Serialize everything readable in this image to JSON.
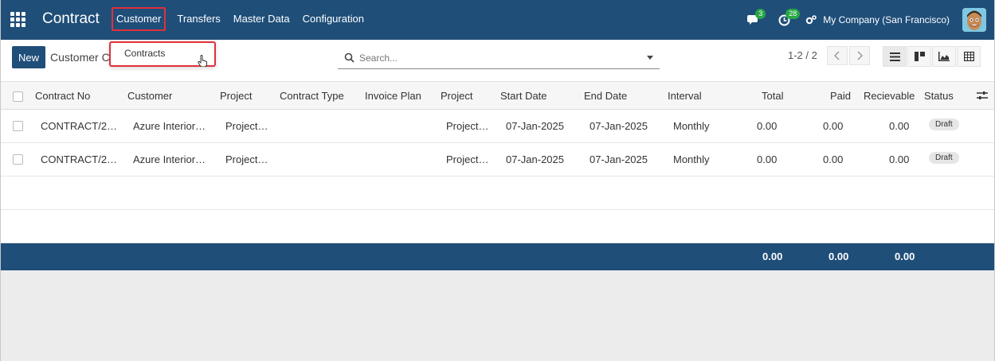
{
  "navbar": {
    "brand": "Contract",
    "menu": [
      "Customer",
      "Transfers",
      "Master Data",
      "Configuration"
    ],
    "messages_count": "3",
    "activities_count": "28",
    "company": "My Company (San Francisco)"
  },
  "dropdown": {
    "item": "Contracts"
  },
  "control": {
    "new_label": "New",
    "breadcrumb": "Customer Contracts",
    "search_placeholder": "Search...",
    "pager": "1-2 / 2"
  },
  "table": {
    "headers": [
      "Contract No",
      "Customer",
      "Project",
      "Contract Type",
      "Invoice Plan",
      "Project",
      "Start Date",
      "End Date",
      "Interval",
      "Total",
      "Paid",
      "Recievable",
      "Status"
    ],
    "rows": [
      {
        "contract_no": "CONTRACT/2…",
        "customer": "Azure Interior…",
        "project": "Project…",
        "contract_type": "",
        "invoice_plan": "",
        "project2": "Project…",
        "start": "07-Jan-2025",
        "end": "07-Jan-2025",
        "interval": "Monthly",
        "total": "0.00",
        "paid": "0.00",
        "receivable": "0.00",
        "status": "Draft"
      },
      {
        "contract_no": "CONTRACT/2…",
        "customer": "Azure Interior…",
        "project": "Project…",
        "contract_type": "",
        "invoice_plan": "",
        "project2": "Project…",
        "start": "07-Jan-2025",
        "end": "07-Jan-2025",
        "interval": "Monthly",
        "total": "0.00",
        "paid": "0.00",
        "receivable": "0.00",
        "status": "Draft"
      }
    ],
    "footer": {
      "total": "0.00",
      "paid": "0.00",
      "receivable": "0.00"
    }
  },
  "colors": {
    "primary": "#1f4e79",
    "highlight": "#e0303a",
    "badge": "#28a745"
  }
}
